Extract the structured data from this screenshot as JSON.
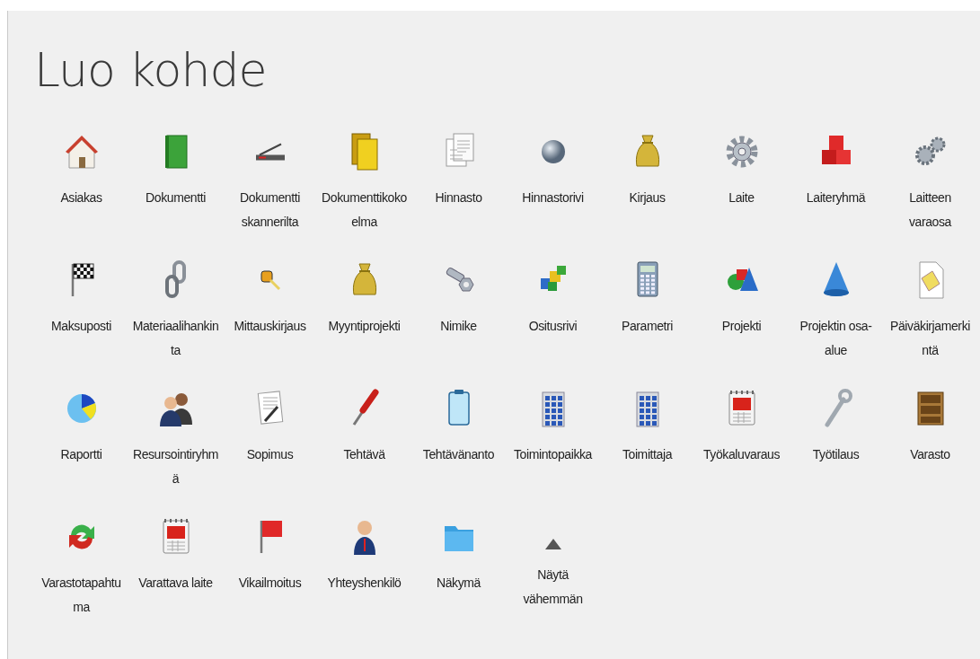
{
  "title": "Luo kohde",
  "items": [
    {
      "kind": "object",
      "label": "Asiakas"
    },
    {
      "kind": "object",
      "label": "Dokumentti"
    },
    {
      "kind": "object",
      "label": "Dokumentti skannerilta"
    },
    {
      "kind": "object",
      "label": "Dokumenttikokoelma"
    },
    {
      "kind": "object",
      "label": "Hinnasto"
    },
    {
      "kind": "object",
      "label": "Hinnastorivi"
    },
    {
      "kind": "object",
      "label": "Kirjaus"
    },
    {
      "kind": "object",
      "label": "Laite"
    },
    {
      "kind": "object",
      "label": "Laiteryhmä"
    },
    {
      "kind": "object",
      "label": "Laitteen varaosa"
    },
    {
      "kind": "object",
      "label": "Maksuposti"
    },
    {
      "kind": "object",
      "label": "Materiaalihankinta"
    },
    {
      "kind": "object",
      "label": "Mittauskirjaus"
    },
    {
      "kind": "object",
      "label": "Myyntiprojekti"
    },
    {
      "kind": "object",
      "label": "Nimike"
    },
    {
      "kind": "object",
      "label": "Ositusrivi"
    },
    {
      "kind": "object",
      "label": "Parametri"
    },
    {
      "kind": "object",
      "label": "Projekti"
    },
    {
      "kind": "object",
      "label": "Projektin osa-alue"
    },
    {
      "kind": "object",
      "label": "Päiväkirjamerkintä"
    },
    {
      "kind": "object",
      "label": "Raportti"
    },
    {
      "kind": "object",
      "label": "Resursointiryhmä"
    },
    {
      "kind": "object",
      "label": "Sopimus"
    },
    {
      "kind": "object",
      "label": "Tehtävä"
    },
    {
      "kind": "object",
      "label": "Tehtävänanto"
    },
    {
      "kind": "object",
      "label": "Toimintopaikka"
    },
    {
      "kind": "object",
      "label": "Toimittaja"
    },
    {
      "kind": "object",
      "label": "Työkaluvaraus"
    },
    {
      "kind": "object",
      "label": "Työtilaus"
    },
    {
      "kind": "object",
      "label": "Varasto"
    },
    {
      "kind": "object",
      "label": "Varastotapahtuma"
    },
    {
      "kind": "object",
      "label": "Varattava laite"
    },
    {
      "kind": "object",
      "label": "Vikailmoitus"
    },
    {
      "kind": "object",
      "label": "Yhteyshenkilö"
    },
    {
      "kind": "object",
      "label": "Näkymä"
    },
    {
      "kind": "collapse",
      "label": "Näytä vähemmän"
    }
  ]
}
